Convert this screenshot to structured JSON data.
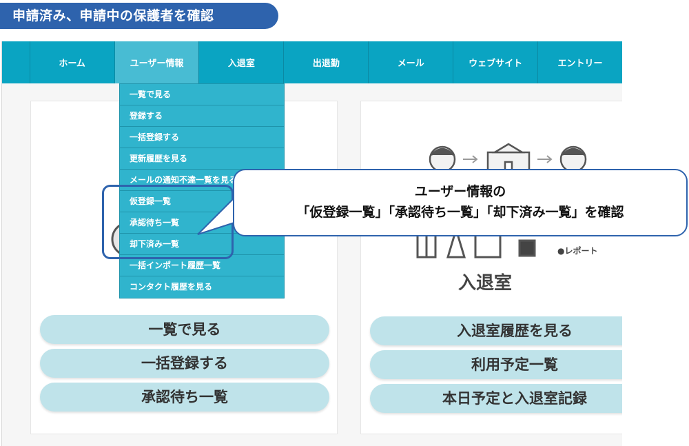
{
  "header": {
    "title": "申請済み、申請中の保護者を確認"
  },
  "nav": {
    "items": [
      {
        "label": "ホーム",
        "active": false
      },
      {
        "label": "ユーザー情報",
        "active": true
      },
      {
        "label": "入退室",
        "active": false
      },
      {
        "label": "出退勤",
        "active": false
      },
      {
        "label": "メール",
        "active": false
      },
      {
        "label": "ウェブサイト",
        "active": false
      },
      {
        "label": "エントリー",
        "active": false
      }
    ]
  },
  "dropdown": {
    "items": [
      "一覧で見る",
      "登録する",
      "一括登録する",
      "更新履歴を見る",
      "メールの通知不達一覧を見る",
      "仮登録一覧",
      "承認待ち一覧",
      "却下済み一覧",
      "一括インポート履歴一覧",
      "コンタクト履歴を見る"
    ],
    "highlighted": [
      "仮登録一覧",
      "承認待ち一覧",
      "却下済み一覧"
    ]
  },
  "callout": {
    "line1": "ユーザー情報の",
    "line2": "「仮登録一覧」「承認待ち一覧」「却下済み一覧」を確認"
  },
  "left_card": {
    "buttons": [
      "一覧で見る",
      "一括登録する",
      "承認待ち一覧"
    ]
  },
  "right_card": {
    "title": "入退室",
    "report_label": "●レポート",
    "buttons": [
      "入退室履歴を見る",
      "利用予定一覧",
      "本日予定と入退室記録"
    ]
  },
  "colors": {
    "accent": "#2e63ad",
    "nav": "#0aa4c2",
    "nav_active": "#48bcd3",
    "dropdown": "#30b4cd",
    "button": "#bfe3ea"
  }
}
